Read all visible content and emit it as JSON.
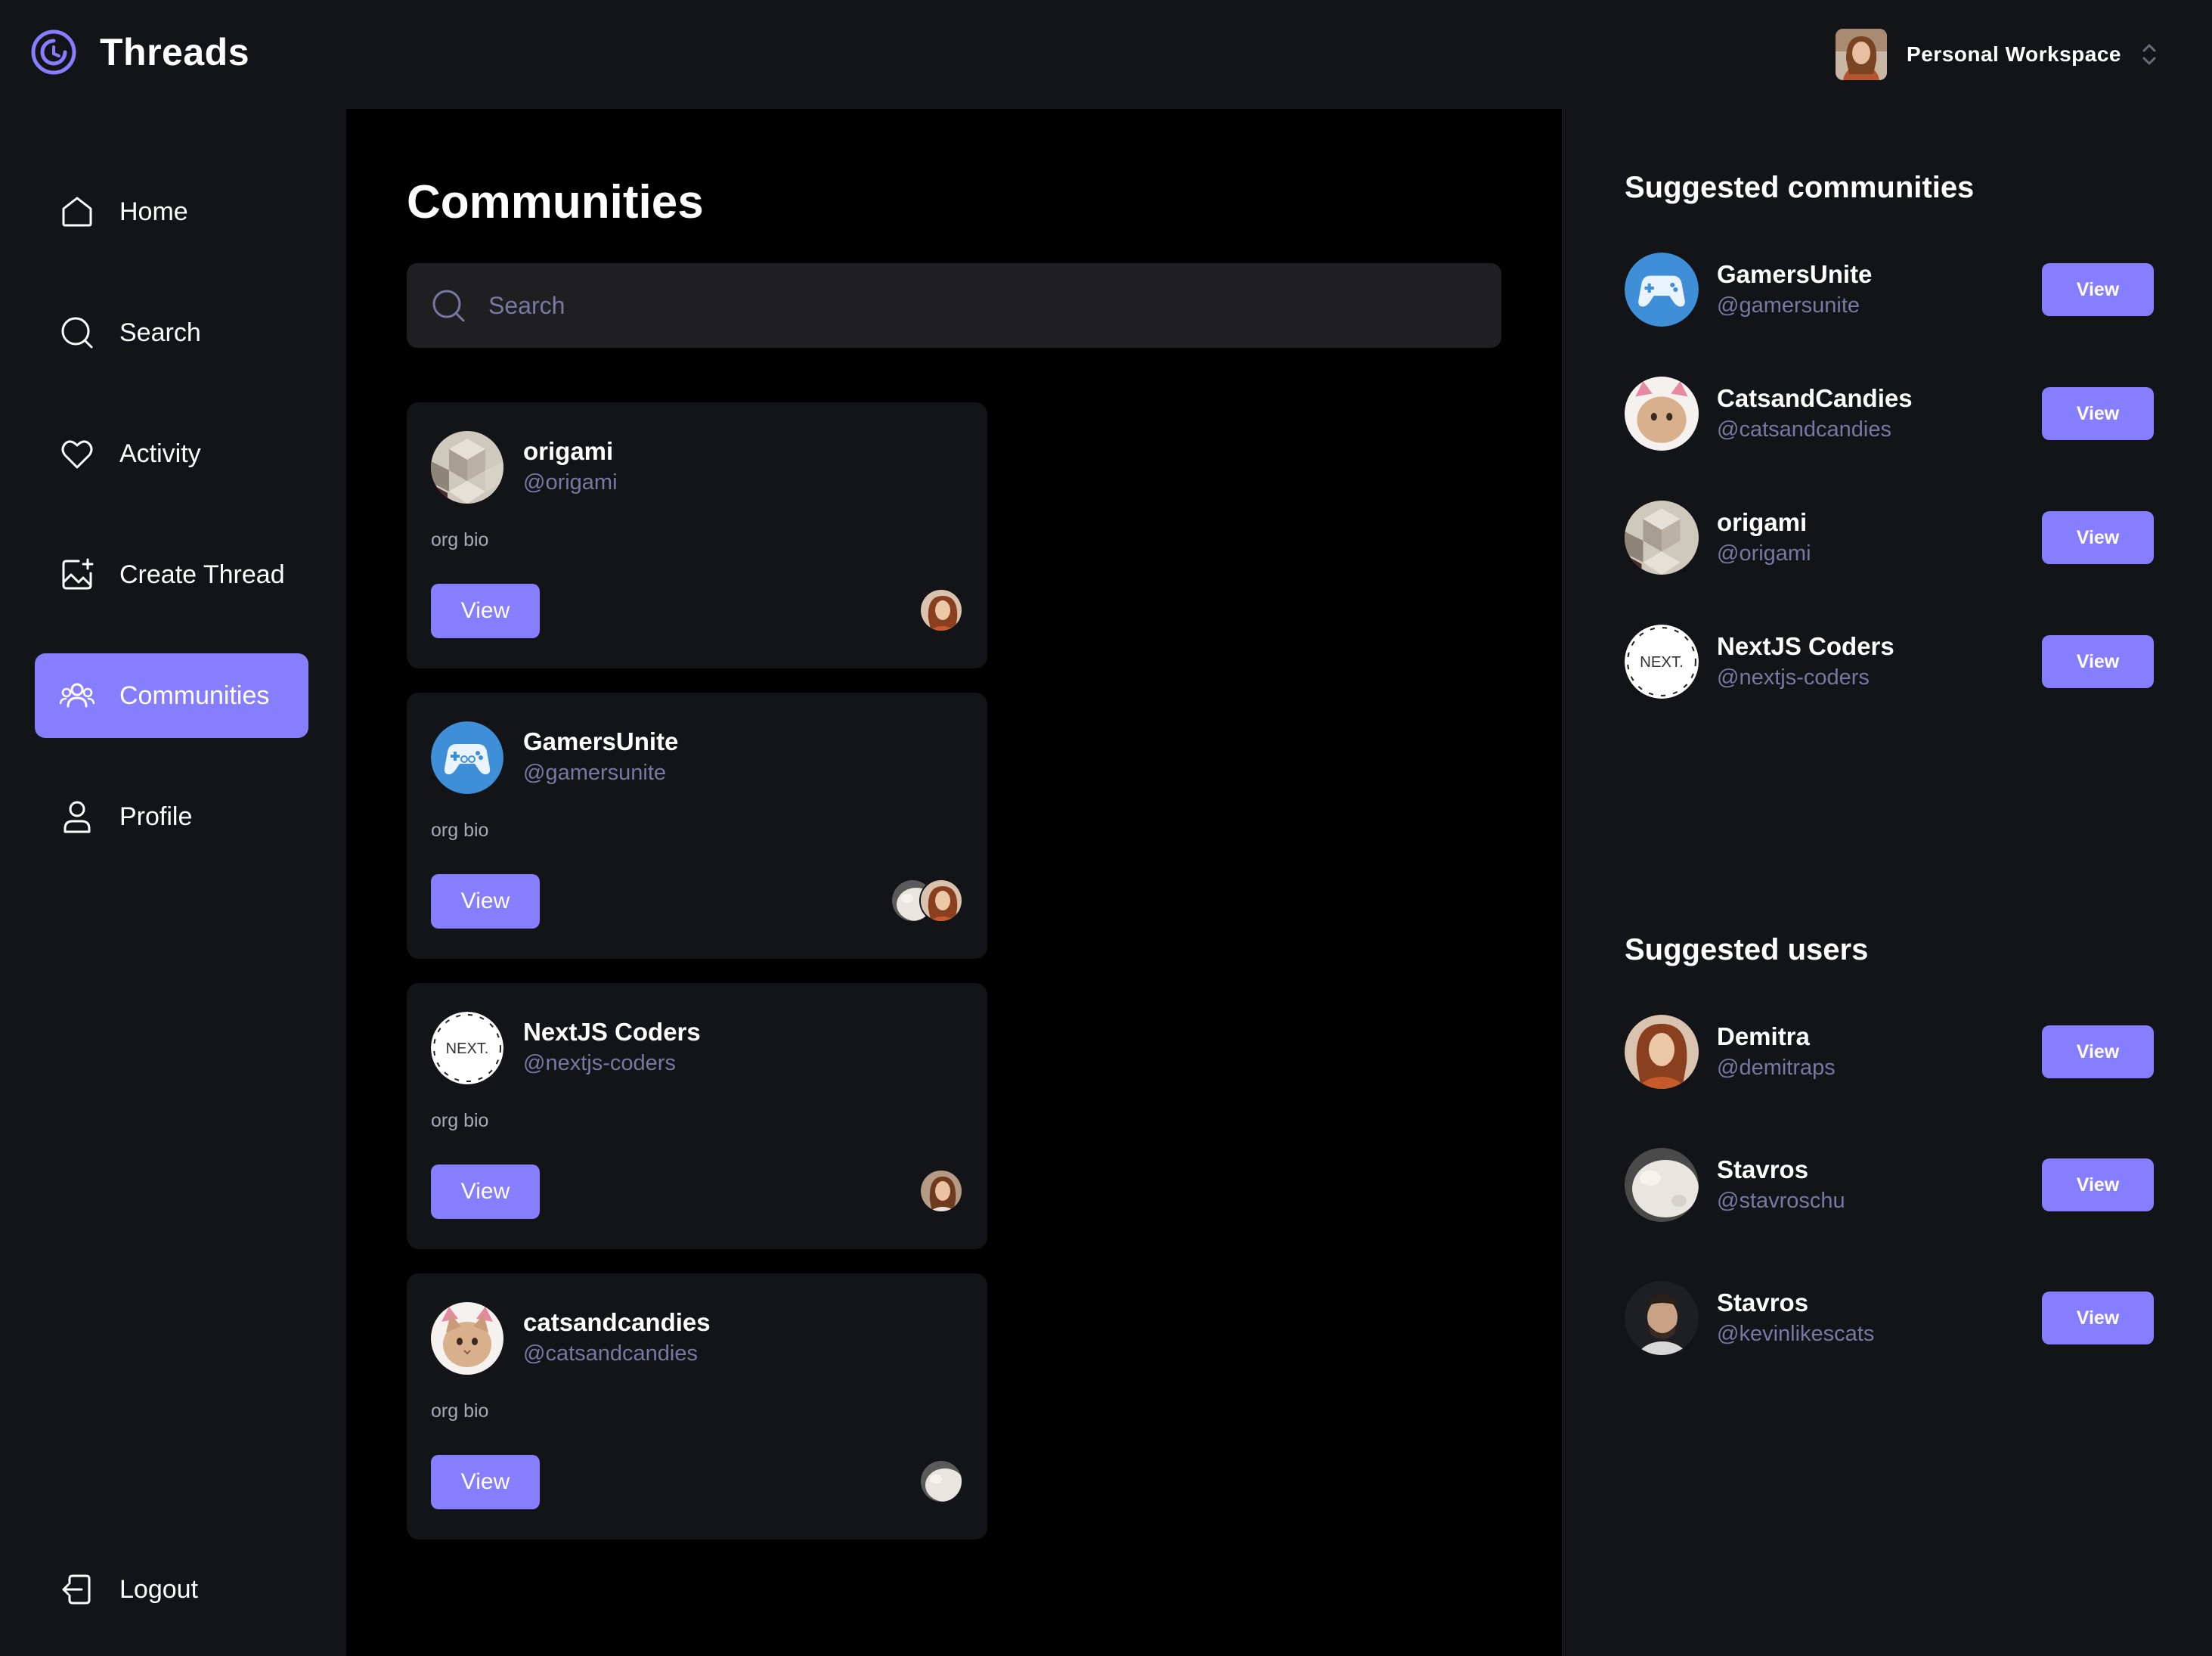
{
  "app": {
    "title": "Threads",
    "workspace": "Personal Workspace"
  },
  "sidebar": {
    "items": [
      {
        "label": "Home",
        "icon": "home-icon"
      },
      {
        "label": "Search",
        "icon": "search-icon"
      },
      {
        "label": "Activity",
        "icon": "heart-icon"
      },
      {
        "label": "Create Thread",
        "icon": "image-plus-icon"
      },
      {
        "label": "Communities",
        "icon": "users-icon",
        "active": true
      },
      {
        "label": "Profile",
        "icon": "user-icon"
      }
    ],
    "logout": "Logout"
  },
  "main": {
    "title": "Communities",
    "search": {
      "placeholder": "Search",
      "value": ""
    },
    "communities": [
      {
        "name": "origami",
        "handle": "@origami",
        "bio": "org bio",
        "view_label": "View",
        "avatar": "origami-avatar",
        "members": [
          "demitra-avatar"
        ]
      },
      {
        "name": "GamersUnite",
        "handle": "@gamersunite",
        "bio": "org bio",
        "view_label": "View",
        "avatar": "gamepad-avatar",
        "members": [
          "stavros-avatar",
          "demitra-avatar"
        ]
      },
      {
        "name": "NextJS Coders",
        "handle": "@nextjs-coders",
        "bio": "org bio",
        "view_label": "View",
        "avatar": "nextjs-avatar",
        "members": [
          "workspace-avatar"
        ]
      },
      {
        "name": "catsandcandies",
        "handle": "@catsandcandies",
        "bio": "org bio",
        "view_label": "View",
        "avatar": "cat-avatar",
        "members": [
          "stavros-avatar"
        ]
      }
    ]
  },
  "right": {
    "suggested_communities_title": "Suggested communities",
    "suggested_communities": [
      {
        "name": "GamersUnite",
        "handle": "@gamersunite",
        "view_label": "View",
        "avatar": "gamepad-avatar"
      },
      {
        "name": "CatsandCandies",
        "handle": "@catsandcandies",
        "view_label": "View",
        "avatar": "cat-avatar"
      },
      {
        "name": "origami",
        "handle": "@origami",
        "view_label": "View",
        "avatar": "origami-avatar"
      },
      {
        "name": "NextJS Coders",
        "handle": "@nextjs-coders",
        "view_label": "View",
        "avatar": "nextjs-avatar"
      }
    ],
    "suggested_users_title": "Suggested users",
    "suggested_users": [
      {
        "name": "Demitra",
        "handle": "@demitraps",
        "view_label": "View",
        "avatar": "demitra-avatar"
      },
      {
        "name": "Stavros",
        "handle": "@stavroschu",
        "view_label": "View",
        "avatar": "stavros-avatar"
      },
      {
        "name": "Stavros",
        "handle": "@kevinlikescats",
        "view_label": "View",
        "avatar": "kevin-avatar"
      }
    ]
  },
  "colors": {
    "accent": "#877EFF",
    "panel": "#121417",
    "card": "#121417",
    "input": "#1F1F22",
    "muted": "#7878A3",
    "background": "#000000"
  }
}
